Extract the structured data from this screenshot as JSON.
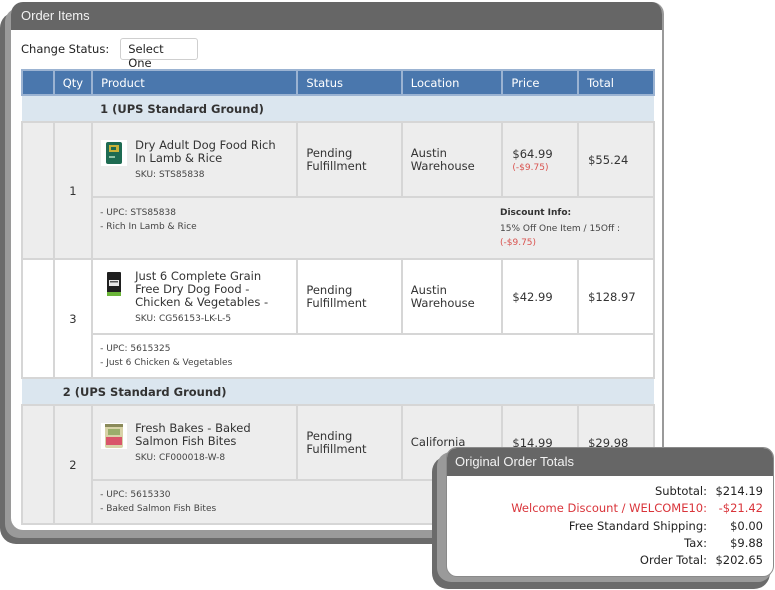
{
  "panel": {
    "title": "Order Items",
    "change_status_label": "Change Status:",
    "status_select_value": "Select One"
  },
  "table": {
    "headers": [
      "",
      "Qty",
      "Product",
      "Status",
      "Location",
      "Price",
      "Total"
    ],
    "groups": [
      {
        "label": "1 (UPS Standard Ground)",
        "items": [
          {
            "qty": "1",
            "name": "Dry Adult Dog Food Rich In Lamb & Rice",
            "sku": "SKU: STS85838",
            "status": "Pending Fulfillment",
            "location": "Austin Warehouse",
            "price": "$64.99",
            "price_discount": "(-$9.75)",
            "total": "$55.24",
            "thumb_icon": "dog-food-bag-green-icon",
            "details": [
              "- UPC: STS85838",
              "- Rich In Lamb & Rice"
            ],
            "discount_info_title": "Discount Info:",
            "discount_info_text": "15% Off One Item  /  15Off :",
            "discount_info_amount": "(-$9.75)"
          },
          {
            "qty": "3",
            "name": "Just 6 Complete Grain Free Dry Dog Food - Chicken & Vegetables -",
            "sku": "SKU: CG56153-LK-L-5",
            "status": "Pending Fulfillment",
            "location": "Austin Warehouse",
            "price": "$42.99",
            "total": "$128.97",
            "thumb_icon": "dog-food-bag-black-icon",
            "details": [
              "- UPC: 5615325",
              "- Just 6 Chicken & Vegetables"
            ]
          }
        ]
      },
      {
        "label": "2 (UPS Standard Ground)",
        "items": [
          {
            "qty": "2",
            "name": "Fresh Bakes - Baked Salmon Fish Bites",
            "sku": "SKU: CF000018-W-8",
            "status": "Pending Fulfillment",
            "location": "California",
            "price": "$14.99",
            "total": "$29.98",
            "thumb_icon": "treat-bag-icon",
            "details": [
              "- UPC: 5615330",
              "- Baked Salmon Fish Bites"
            ]
          }
        ]
      }
    ]
  },
  "totals": {
    "title": "Original Order Totals",
    "rows": [
      {
        "label": "Subtotal:",
        "value": "$214.19"
      },
      {
        "label": "Welcome Discount / WELCOME10:",
        "value": "-$21.42"
      },
      {
        "label": "Free Standard Shipping:",
        "value": "$0.00"
      },
      {
        "label": "Tax:",
        "value": "$9.88"
      },
      {
        "label": "Order Total:",
        "value": "$202.65"
      }
    ]
  },
  "colors": {
    "header_bg": "#666666",
    "table_header_bg": "#4a77ad",
    "group_row_bg": "#dbe6ef",
    "discount_red": "#d9534f"
  }
}
